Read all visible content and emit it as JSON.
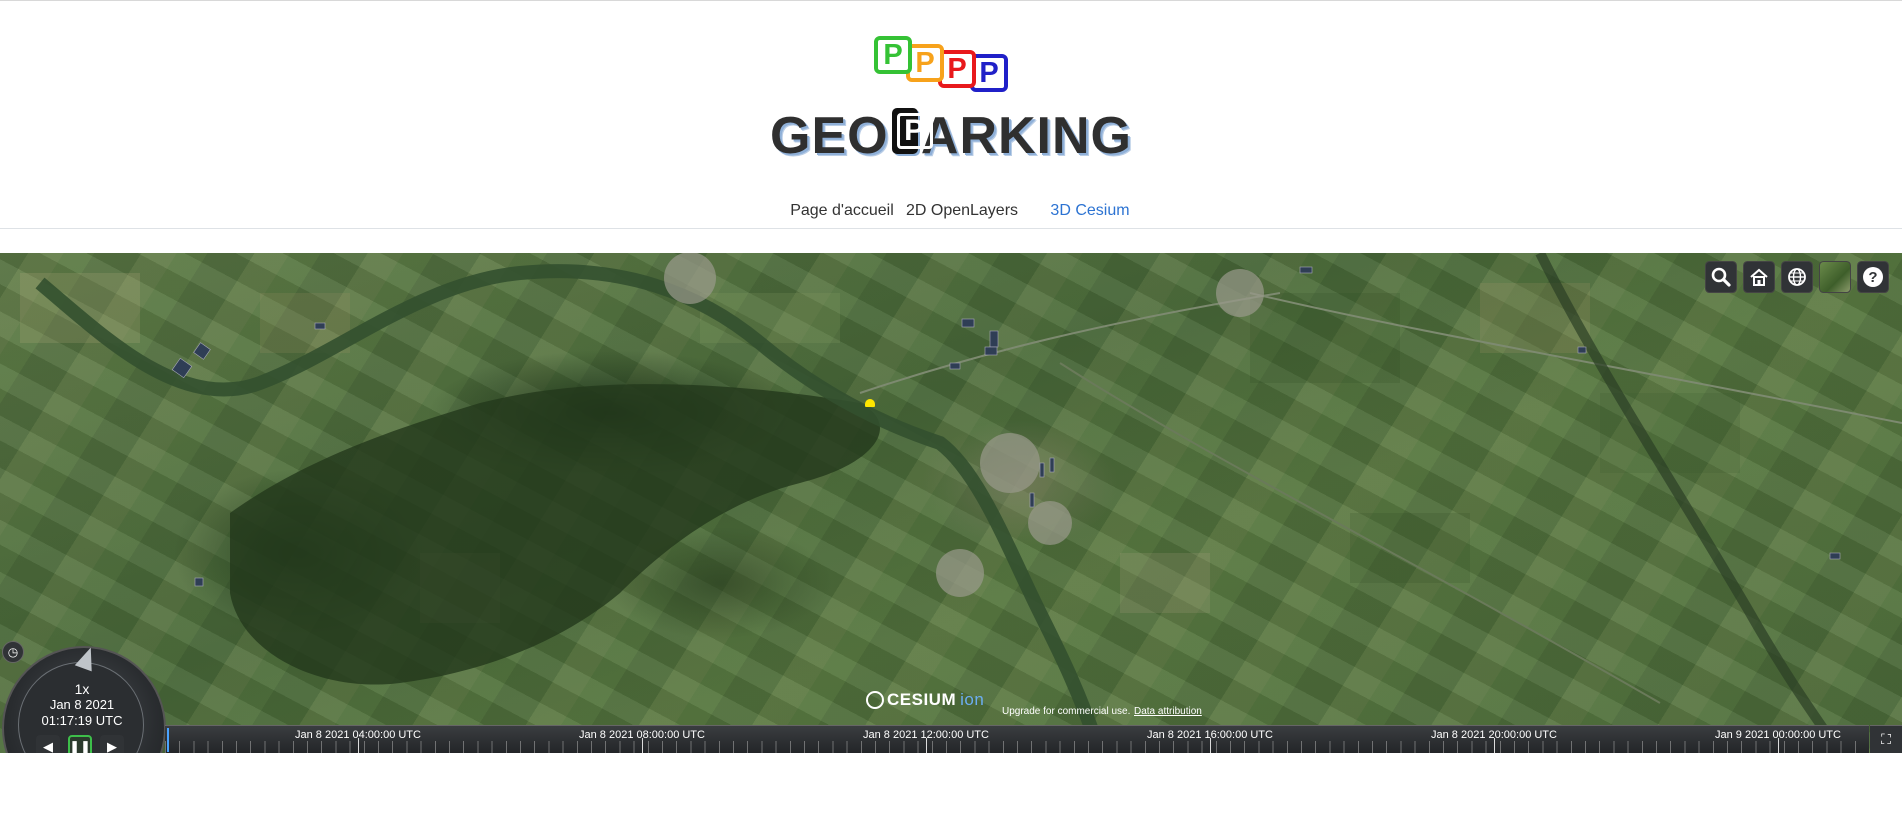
{
  "logo": {
    "tile_letter": "P",
    "word_left": "GEO",
    "word_p": "P",
    "word_right": "ARKING",
    "tile_colors": [
      "#35c235",
      "#f7a21b",
      "#e8191c",
      "#2020c8"
    ]
  },
  "nav": {
    "tabs": [
      {
        "label": "Page d'accueil"
      },
      {
        "label": "2D OpenLayers"
      },
      {
        "label": "3D Cesium"
      }
    ],
    "active_color": "#2c73d2"
  },
  "viewer": {
    "toolbar": [
      {
        "icon": "search-icon"
      },
      {
        "icon": "home-icon"
      },
      {
        "icon": "globe-icon"
      },
      {
        "icon": "imagery-layer-icon"
      },
      {
        "icon": "help-icon"
      }
    ],
    "credits": {
      "logo_text": "CESIUM",
      "logo_suffix": "ion",
      "upgrade_text": "Upgrade for commercial use.",
      "attribution_link": "Data attribution"
    },
    "animation": {
      "speed": "1x",
      "date": "Jan 8 2021",
      "time": "01:17:19 UTC"
    },
    "timeline": {
      "labels": [
        "Jan 8 2021 04:00:00 UTC",
        "Jan 8 2021 08:00:00 UTC",
        "Jan 8 2021 12:00:00 UTC",
        "Jan 8 2021 16:00:00 UTC",
        "Jan 8 2021 20:00:00 UTC",
        "Jan 9 2021 00:00:00 UTC"
      ]
    }
  }
}
